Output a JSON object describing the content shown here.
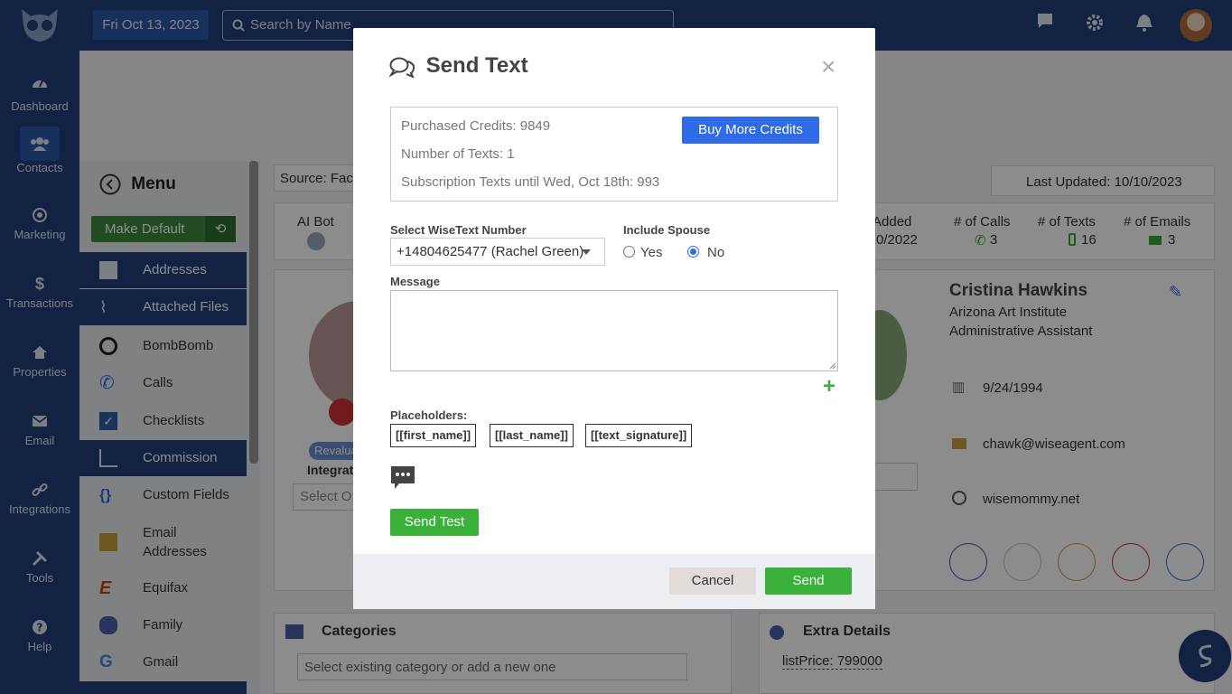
{
  "topbar": {
    "date": "Fri Oct 13, 2023",
    "search_placeholder": "Search by Name"
  },
  "nav": [
    {
      "label": "Dashboard",
      "icon": "gauge-icon"
    },
    {
      "label": "Contacts",
      "icon": "users-icon",
      "active": true
    },
    {
      "label": "Marketing",
      "icon": "bullseye-icon"
    },
    {
      "label": "Transactions",
      "icon": "dollar-icon"
    },
    {
      "label": "Properties",
      "icon": "home-icon"
    },
    {
      "label": "Email",
      "icon": "envelope-icon"
    },
    {
      "label": "Integrations",
      "icon": "link-icon"
    },
    {
      "label": "Tools",
      "icon": "tools-icon"
    },
    {
      "label": "Help",
      "icon": "question-icon"
    }
  ],
  "menu": {
    "title": "Menu",
    "make_default": "Make Default",
    "items": [
      {
        "label": "Addresses",
        "selected": true
      },
      {
        "label": "Attached Files",
        "selected": true
      },
      {
        "label": "BombBomb"
      },
      {
        "label": "Calls"
      },
      {
        "label": "Checklists"
      },
      {
        "label": "Commission",
        "selected": true
      },
      {
        "label": "Custom Fields"
      },
      {
        "label": "Email\nAddresses"
      },
      {
        "label": "Equifax"
      },
      {
        "label": "Family"
      },
      {
        "label": "Gmail"
      }
    ]
  },
  "background": {
    "source": "Source: Face",
    "last_updated": "Last Updated: 10/10/2023",
    "ai_bot": "AI Bot",
    "added": "Added",
    "added_date": "0/2022",
    "calls_label": "# of Calls",
    "calls_count": "3",
    "texts_label": "# of Texts",
    "texts_count": "16",
    "emails_label": "# of Emails",
    "emails_count": "3",
    "revalua": "Revalua",
    "integrat": "Integrat",
    "select_o": "Select O",
    "contact_name": "Cristina Hawkins",
    "contact_company": "Arizona Art Institute",
    "contact_title": "Administrative Assistant",
    "birthday": "9/24/1994",
    "email": "chawk@wiseagent.com",
    "website": "wisemommy.net",
    "categories_title": "Categories",
    "categories_placeholder": "Select existing category or add a new one",
    "extra_title": "Extra Details",
    "list_price": "listPrice: 799000"
  },
  "modal": {
    "title": "Send Text",
    "close": "×",
    "purchased_credits": "Purchased Credits: 9849",
    "number_of_texts": "Number of Texts: 1",
    "subscription_texts": "Subscription Texts until Wed, Oct 18th: 993",
    "buy_more": "Buy More Credits",
    "select_label": "Select WiseText Number",
    "select_value": "+14804625477 (Rachel Green)",
    "spouse_label": "Include Spouse",
    "yes": "Yes",
    "no": "No",
    "message_label": "Message",
    "placeholders_label": "Placeholders:",
    "placeholders": [
      "[[first_name]]",
      "[[last_name]]",
      "[[text_signature]]"
    ],
    "send_test": "Send Test",
    "cancel": "Cancel",
    "send": "Send"
  },
  "colors": {
    "nav_bg": "#1f3f78",
    "primary_blue": "#2f6be7",
    "green": "#3bb13b"
  }
}
